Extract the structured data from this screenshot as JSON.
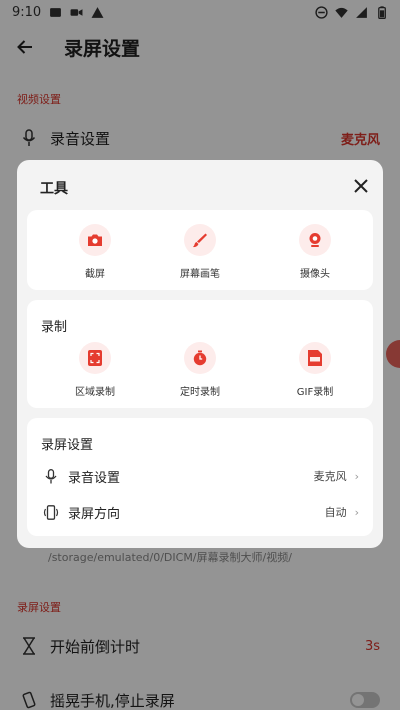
{
  "status_bar": {
    "time": "9:10"
  },
  "app_bar": {
    "title": "录屏设置"
  },
  "sections": {
    "video": "视频设置",
    "record": "录屏设置"
  },
  "background_rows": {
    "audio": {
      "label": "录音设置",
      "value": "麦克风"
    },
    "storage_path": "/storage/emulated/0/DICM/屏幕录制大师/视频/",
    "countdown": {
      "label": "开始前倒计时",
      "value": "3s"
    },
    "shake_stop": {
      "label": "摇晃手机,停止录屏",
      "enabled": false
    }
  },
  "dialog": {
    "title": "工具",
    "tools_card": {
      "items": [
        {
          "label": "截屏",
          "icon": "camera-icon"
        },
        {
          "label": "屏幕画笔",
          "icon": "brush-icon"
        },
        {
          "label": "摄像头",
          "icon": "webcam-icon"
        }
      ]
    },
    "record_card": {
      "title": "录制",
      "items": [
        {
          "label": "区域录制",
          "icon": "area-record-icon"
        },
        {
          "label": "定时录制",
          "icon": "timer-icon"
        },
        {
          "label": "GIF录制",
          "icon": "gif-icon"
        }
      ]
    },
    "settings_card": {
      "title": "录屏设置",
      "rows": [
        {
          "label": "录音设置",
          "value": "麦克风",
          "icon": "microphone-icon"
        },
        {
          "label": "录屏方向",
          "value": "自动",
          "icon": "orientation-icon"
        }
      ]
    }
  },
  "colors": {
    "accent": "#d9352b",
    "icon_bg": "#fdeceb",
    "scrim": "rgba(0,0,0,0.42)"
  }
}
